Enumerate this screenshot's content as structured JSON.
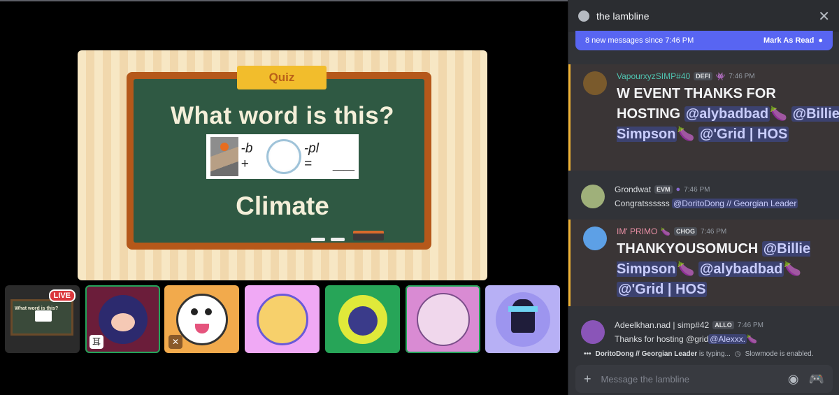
{
  "slide": {
    "banner": "Quiz",
    "question": "What word is this?",
    "rebus_text_1": "-b +",
    "rebus_text_2": "-pl =",
    "rebus_blank": "____",
    "answer": "Climate"
  },
  "tiles": {
    "live_badge": "LIVE",
    "tile0_preview_caption": "What word is this?"
  },
  "chat": {
    "title": "the lambline",
    "new_messages": "8 new messages since 7:46 PM",
    "mark_read": "Mark As Read",
    "messages": [
      {
        "user": "VapourxyzSIMP#40",
        "tag": "DEFI",
        "time": "7:46 PM",
        "text": "W EVENT THANKS FOR HOSTING",
        "m1": "@alybadbad",
        "m2": "@Billie Simpson",
        "m3": "@'Grid | HOS",
        "emoji": "🍆"
      },
      {
        "user": "Grondwat",
        "tag": "EVM",
        "time": "7:46 PM",
        "text": "Congratssssss",
        "m1": "@DoritoDong // Georgian Leader"
      },
      {
        "user": "IM' PRIMO",
        "tag": "CHOG",
        "time": "7:46 PM",
        "text": "THANKYOUSOMUCH",
        "m1": "@Billie Simpson",
        "m2": "@alybadbad",
        "m3": "@'Grid | HOS",
        "emoji": "🍆"
      },
      {
        "user": "Adeelkhan.nad | simp#42",
        "tag": "ALLO",
        "time": "7:46 PM",
        "text": "Thanks for hosting @grid",
        "m1": "@Alexxx.",
        "emoji": "🍆"
      }
    ],
    "typing_user": "DoritoDong // Georgian Leader",
    "typing_text": "is typing...",
    "slowmode": "Slowmode is enabled.",
    "composer_placeholder": "Message the lambline"
  },
  "colors": {
    "accent": "#5865f2",
    "live": "#da373c",
    "speaking": "#23a55a",
    "highlight": "#f0b232"
  }
}
